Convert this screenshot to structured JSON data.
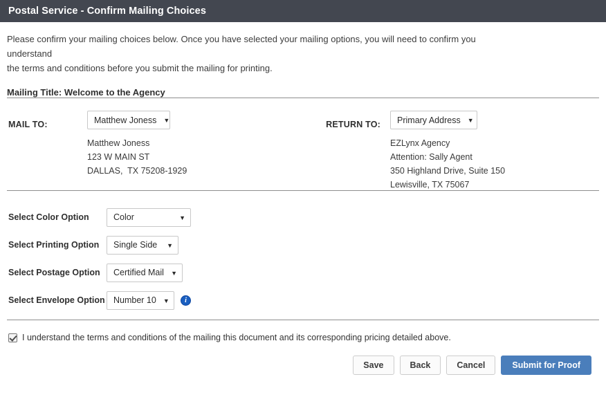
{
  "window": {
    "title": "Postal Service - Confirm Mailing Choices"
  },
  "intro": {
    "line1": "Please confirm your mailing choices below. Once you have selected your mailing options, you will need to confirm you understand",
    "line2": "the terms and conditions before you submit the mailing for printing."
  },
  "mailing_title": "Mailing Title: Welcome to the Agency",
  "mail_to": {
    "label": "MAIL TO:",
    "selected": "Matthew Joness",
    "caret": "▼",
    "address": [
      "Matthew Joness",
      "123 W MAIN ST",
      "DALLAS,  TX 75208-1929"
    ]
  },
  "return_to": {
    "label": "RETURN TO:",
    "selected": "Primary Address",
    "caret": "▼",
    "address": [
      "EZLynx Agency",
      "Attention: Sally Agent",
      "350 Highland Drive, Suite 150",
      "Lewisville, TX 75067"
    ]
  },
  "options": [
    {
      "label": "Select Color Option",
      "selected": "Color",
      "caret": "▼",
      "info": false
    },
    {
      "label": "Select Printing Option",
      "selected": "Single Side",
      "caret": "▼",
      "info": false
    },
    {
      "label": "Select Postage Option",
      "selected": "Certified Mail",
      "caret": "▼",
      "info": false
    },
    {
      "label": "Select Envelope Option",
      "selected": "Number 10",
      "caret": "▼",
      "info": true,
      "info_glyph": "i"
    }
  ],
  "terms": {
    "checked": true,
    "text": "I understand the terms and conditions of the mailing this document and its corresponding pricing detailed above."
  },
  "buttons": {
    "save": "Save",
    "back": "Back",
    "cancel": "Cancel",
    "submit": "Submit for Proof"
  },
  "colors": {
    "titlebar": "#434750",
    "primary_button": "#4a7ebb",
    "info_icon": "#1a5fc0",
    "divider": "#8e8e8e"
  }
}
